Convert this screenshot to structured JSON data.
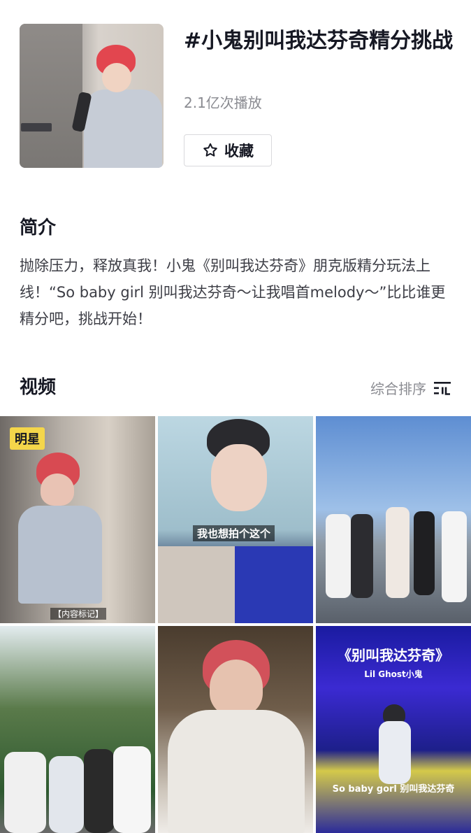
{
  "challenge": {
    "title": "#小鬼别叫我达芬奇精分挑战",
    "plays": "2.1亿次播放",
    "favorite_label": "收藏"
  },
  "intro": {
    "heading": "简介",
    "text": "抛除压力，释放真我！小鬼《别叫我达芬奇》朋克版精分玩法上线！“So baby girl 别叫我达芬奇～让我唱首melody～”比比谁更精分吧，挑战开始！"
  },
  "videos": {
    "heading": "视频",
    "sort_label": "综合排序",
    "items": [
      {
        "badge": "明星",
        "caption": "",
        "caption_bottom": "【内容标记】"
      },
      {
        "caption": "我也想拍个这个"
      },
      {},
      {},
      {},
      {
        "caption_top": "《别叫我达芬奇》",
        "caption_sub": "Lil Ghost小鬼",
        "caption_low": "So baby gorl 别叫我达芬奇"
      }
    ]
  },
  "colors": {
    "accent_badge": "#f4d64a",
    "text_primary": "#161823",
    "text_secondary": "#8a8b91"
  },
  "icons": {
    "favorite": "star-outline-icon",
    "sort": "sort-filter-icon"
  }
}
